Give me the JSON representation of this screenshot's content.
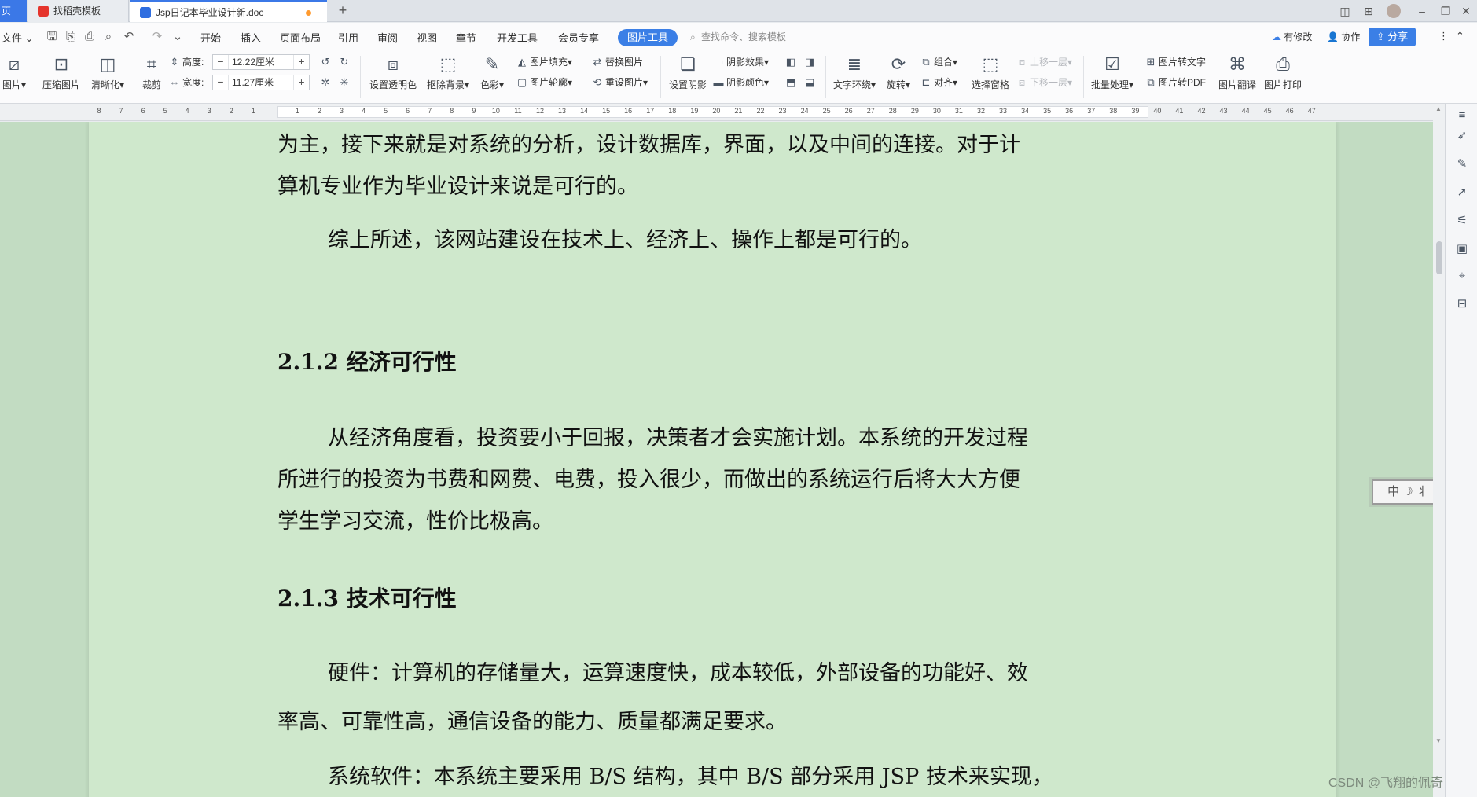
{
  "tabs": {
    "home_label": "页",
    "tab1_label": "找稻壳模板",
    "tab2_label": "Jsp日记本毕业设计新.doc",
    "new_tab": "+"
  },
  "window": {
    "layout_icon": "◫",
    "grid_icon": "⊞",
    "minimize": "–",
    "restore": "❐",
    "close": "✕"
  },
  "menu": {
    "file": "文件",
    "items": [
      "开始",
      "插入",
      "页面布局",
      "引用",
      "审阅",
      "视图",
      "章节",
      "开发工具",
      "会员专享"
    ],
    "picture_tools": "图片工具",
    "search_placeholder": "查找命令、搜索模板",
    "revisions": "有修改",
    "collaborate": "协作",
    "share": "分享"
  },
  "ribbon": {
    "picture": "图片",
    "compress": "压缩图片",
    "sharpen": "清晰化",
    "crop": "裁剪",
    "height_label": "高度:",
    "height_value": "12.22厘米",
    "width_label": "宽度:",
    "width_value": "11.27厘米",
    "set_transparent": "设置透明色",
    "remove_bg": "抠除背景",
    "color": "色彩",
    "picture_fill": "图片填充",
    "picture_outline": "图片轮廓",
    "replace_picture": "替换图片",
    "reset_picture": "重设图片",
    "set_shadow": "设置阴影",
    "shadow_effect": "阴影效果",
    "shadow_color": "阴影颜色",
    "text_wrap": "文字环绕",
    "rotate": "旋转",
    "group": "组合",
    "align": "对齐",
    "selection_pane": "选择窗格",
    "bring_forward": "上移一层",
    "send_backward": "下移一层",
    "batch_process": "批量处理",
    "pic_to_text": "图片转文字",
    "pic_to_pdf": "图片转PDF",
    "pic_translate": "图片翻译",
    "pic_print": "图片打印"
  },
  "ruler": {
    "labels": [
      "8",
      "7",
      "6",
      "5",
      "4",
      "3",
      "2",
      "1",
      "",
      "1",
      "2",
      "3",
      "4",
      "5",
      "6",
      "7",
      "8",
      "9",
      "10",
      "11",
      "12",
      "13",
      "14",
      "15",
      "16",
      "17",
      "18",
      "19",
      "20",
      "21",
      "22",
      "23",
      "24",
      "25",
      "26",
      "27",
      "28",
      "29",
      "30",
      "31",
      "32",
      "33",
      "34",
      "35",
      "36",
      "37",
      "38",
      "39",
      "40",
      "41",
      "42",
      "43",
      "44",
      "45",
      "46",
      "47"
    ]
  },
  "document": {
    "p1_line1": "为主，接下来就是对系统的分析，设计数据库，界面，以及中间的连接。对于计",
    "p1_line2": "算机专业作为毕业设计来说是可行的。",
    "p2": "综上所述，该网站建设在技术上、经济上、操作上都是可行的。",
    "h1": "2.1.2  经济可行性",
    "p3_line1": "从经济角度看，投资要小于回报，决策者才会实施计划。本系统的开发过程",
    "p3_line2": "所进行的投资为书费和网费、电费，投入很少，而做出的系统运行后将大大方便",
    "p3_line3": "学生学习交流，性价比极高。",
    "h2": "2.1.3  技术可行性",
    "p4_line1": "硬件：计算机的存储量大，运算速度快，成本较低，外部设备的功能好、效",
    "p4_line2": "率高、可靠性高，通信设备的能力、质量都满足要求。",
    "p5_line1": "系统软件：本系统主要采用 B/S 结构，其中 B/S 部分采用 JSP 技术来实现，"
  },
  "ime": {
    "text": "中 ☽ ⺦"
  },
  "watermark": "CSDN @飞翔的佩奇"
}
